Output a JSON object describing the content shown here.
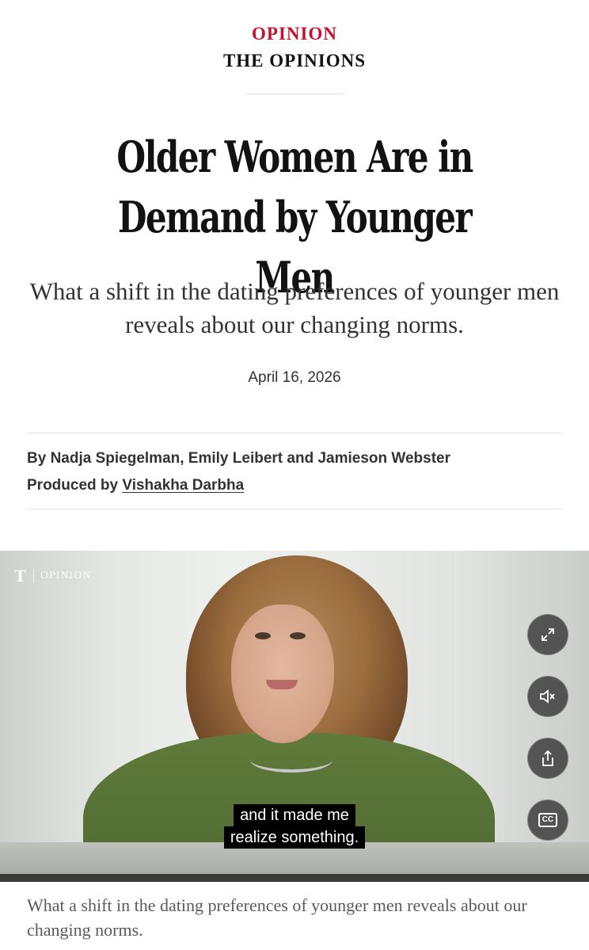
{
  "header": {
    "kicker": "OPINION",
    "section": "THE OPINIONS"
  },
  "article": {
    "headline_line1": "Older Women Are in",
    "headline_line2": "Demand by Younger Men",
    "dek": "What a shift in the dating preferences of younger men reveals about our changing norms.",
    "date": "April 16, 2026",
    "byline_prefix": "By ",
    "byline_authors": "Nadja Spiegelman, Emily Leibert and Jamieson Webster",
    "producer_prefix": "Produced by ",
    "producer_name": "Vishakha Darbha"
  },
  "video": {
    "logo_text": "OPINION",
    "logo_glyph": "T",
    "subtitle_line1": "and it made me",
    "subtitle_line2": "realize something.",
    "cc_label": "CC",
    "caption": "What a shift in the dating preferences of younger men reveals about our changing norms."
  },
  "colors": {
    "kicker": "#c8102e",
    "text": "#121212",
    "control_bg": "#373737"
  },
  "icons": [
    "expand-icon",
    "mute-icon",
    "share-icon",
    "closed-captions-icon"
  ]
}
